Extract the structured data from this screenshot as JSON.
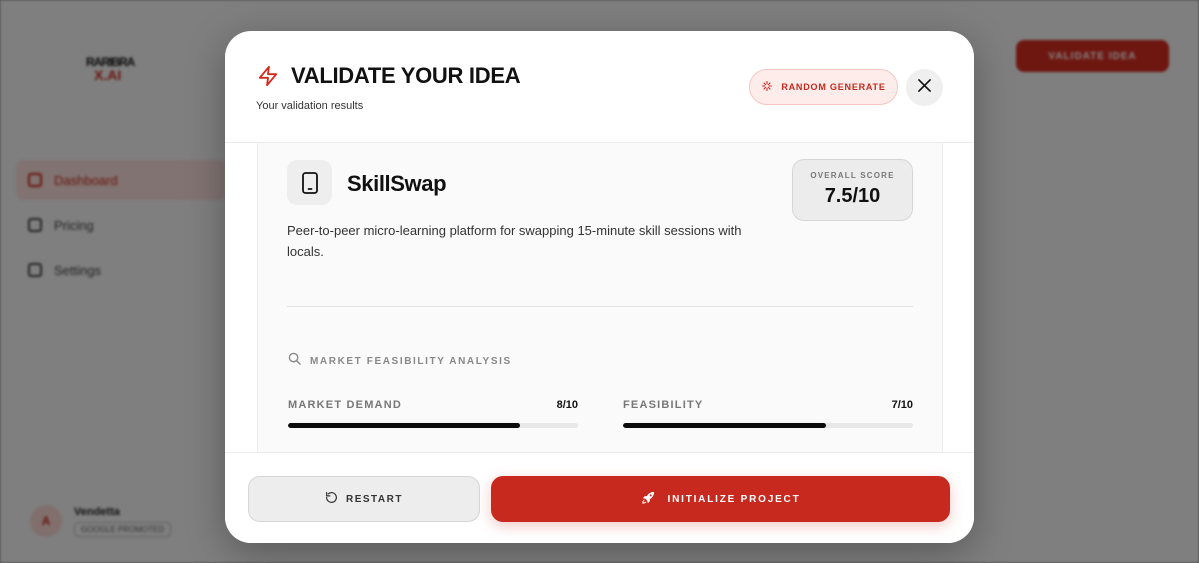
{
  "background": {
    "logo": {
      "line1": "RARIBRA",
      "line2": "X.AI"
    },
    "nav": [
      {
        "label": "Dashboard",
        "icon": "dashboard-icon",
        "active": true
      },
      {
        "label": "Pricing",
        "icon": "credit-card-icon",
        "active": false
      },
      {
        "label": "Settings",
        "icon": "settings-icon",
        "active": false
      }
    ],
    "validate_button": "VALIDATE IDEA",
    "user": {
      "initial": "A",
      "name": "Vendetta",
      "plan": "GOOGLE PROMOTED"
    }
  },
  "modal": {
    "title": "VALIDATE YOUR IDEA",
    "subtitle": "Your validation results",
    "random_button": "RANDOM GENERATE",
    "icons": {
      "title": "bolt-icon",
      "random": "sparkle-icon",
      "close": "close-icon"
    }
  },
  "project": {
    "name": "SkillSwap",
    "description": "Peer-to-peer micro-learning platform for swapping 15-minute skill sessions with locals.",
    "icon": "tablet-icon",
    "overall_score_label": "OVERALL SCORE",
    "overall_score": "7.5/10"
  },
  "analysis": {
    "title": "MARKET FEASIBILITY ANALYSIS",
    "metrics": [
      {
        "label": "MARKET DEMAND",
        "value": "8/10",
        "fraction": 0.8
      },
      {
        "label": "FEASIBILITY",
        "value": "7/10",
        "fraction": 0.7
      }
    ]
  },
  "footer": {
    "restart_label": "RESTART",
    "initialize_label": "INITIALIZE PROJECT"
  },
  "colors": {
    "accent": "#c8291e",
    "accent_soft": "#fdecea",
    "bar": "#0d0d0d"
  }
}
